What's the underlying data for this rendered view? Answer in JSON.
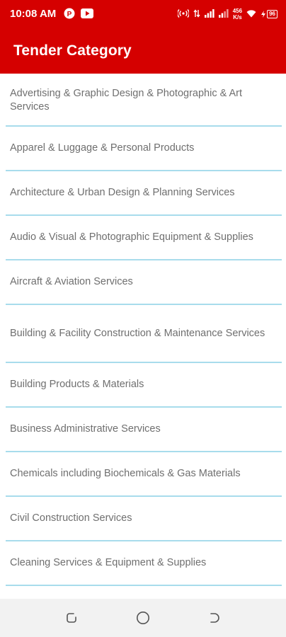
{
  "status_bar": {
    "time": "10:08 AM",
    "speed_top": "456",
    "speed_bottom": "K/s",
    "battery": "96",
    "icons": [
      "notification-p-icon",
      "youtube-icon",
      "hotspot-icon",
      "data-arrows-icon",
      "signal-icon",
      "signal-icon-2",
      "wifi-icon",
      "battery-icon"
    ]
  },
  "app_bar": {
    "title": "Tender Category"
  },
  "categories": [
    {
      "label": "Advertising & Graphic Design & Photographic & Art Services"
    },
    {
      "label": "Apparel & Luggage & Personal Products"
    },
    {
      "label": "Architecture & Urban Design & Planning Services"
    },
    {
      "label": "Audio & Visual & Photographic Equipment & Supplies"
    },
    {
      "label": "Aircraft & Aviation Services"
    },
    {
      "label": "Building & Facility Construction & Maintenance Services"
    },
    {
      "label": "Building Products & Materials"
    },
    {
      "label": "Business Administrative Services"
    },
    {
      "label": "Chemicals including Biochemicals & Gas Materials"
    },
    {
      "label": "Civil Construction Services"
    },
    {
      "label": "Cleaning Services & Equipment & Supplies"
    }
  ],
  "nav_bar": {
    "icons": [
      "recent-apps-icon",
      "home-icon",
      "back-icon"
    ]
  },
  "colors": {
    "primary": "#d50000",
    "divider": "#a8dcec",
    "text": "#6f6f6f",
    "nav_bg": "#f2f2f2"
  }
}
